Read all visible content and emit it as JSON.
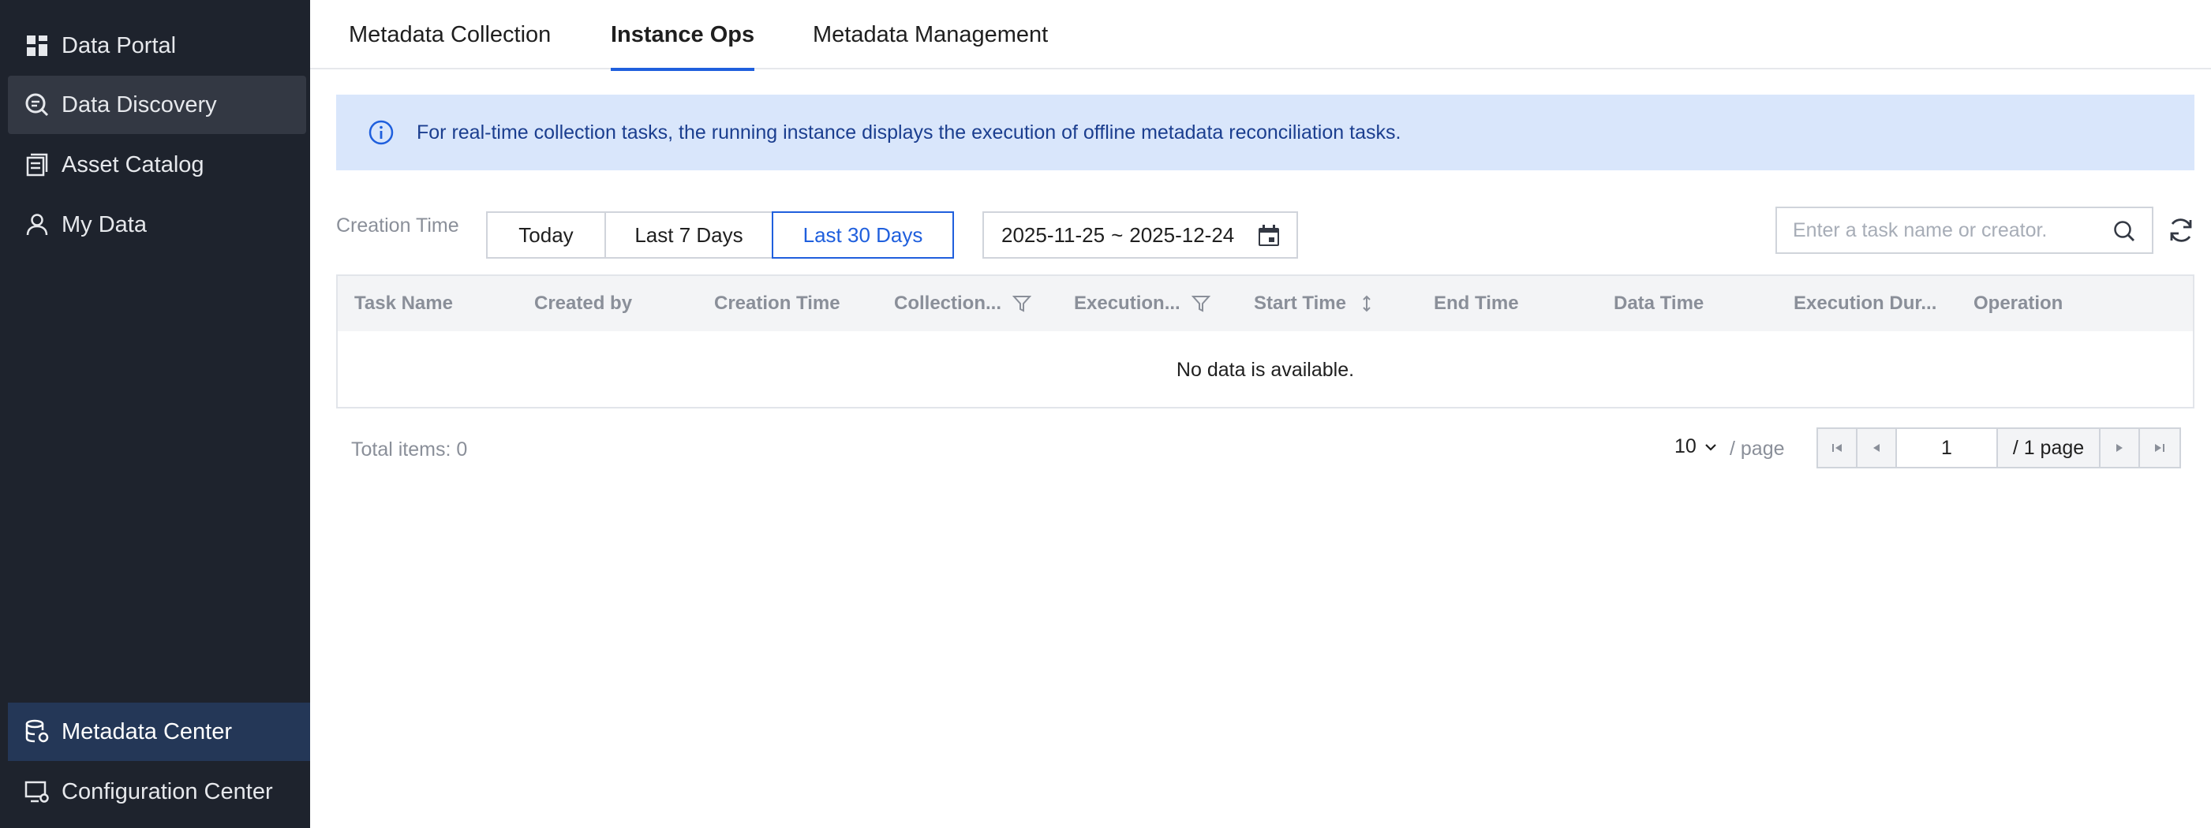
{
  "sidebar": {
    "items": [
      {
        "label": "Data Portal",
        "icon": "grid-icon"
      },
      {
        "label": "Data Discovery",
        "icon": "search-document-icon"
      },
      {
        "label": "Asset Catalog",
        "icon": "catalog-icon"
      },
      {
        "label": "My Data",
        "icon": "user-icon"
      }
    ],
    "bottom_items": [
      {
        "label": "Metadata Center",
        "icon": "database-gear-icon"
      },
      {
        "label": "Configuration Center",
        "icon": "monitor-gear-icon"
      }
    ]
  },
  "tabs": [
    {
      "label": "Metadata Collection"
    },
    {
      "label": "Instance Ops"
    },
    {
      "label": "Metadata Management"
    }
  ],
  "banner": {
    "text": "For real-time collection tasks, the running instance displays the execution of offline metadata reconciliation tasks.",
    "icon": "info-icon"
  },
  "filter": {
    "label": "Creation Time",
    "ranges": [
      "Today",
      "Last 7 Days",
      "Last 30 Days"
    ],
    "selected": "Last 30 Days",
    "date_start": "2025-11-25",
    "date_sep": "~",
    "date_end": "2025-12-24"
  },
  "search": {
    "placeholder": "Enter a task name or creator."
  },
  "table": {
    "columns": [
      {
        "label": "Task Name"
      },
      {
        "label": "Created by"
      },
      {
        "label": "Creation Time"
      },
      {
        "label": "Collection..."
      },
      {
        "label": "Execution..."
      },
      {
        "label": "Start Time"
      },
      {
        "label": "End Time"
      },
      {
        "label": "Data Time"
      },
      {
        "label": "Execution Dur..."
      },
      {
        "label": "Operation"
      }
    ],
    "empty_text": "No data is available."
  },
  "pagination": {
    "total_label": "Total items:",
    "total": "0",
    "page_size": "10",
    "per_page_label": "/ page",
    "current_page": "1",
    "total_pages_label": "/ 1 page"
  },
  "colors": {
    "accent": "#1f5fdd",
    "sidebar_bg": "#1e232d",
    "banner_bg": "#d9e6fb"
  }
}
